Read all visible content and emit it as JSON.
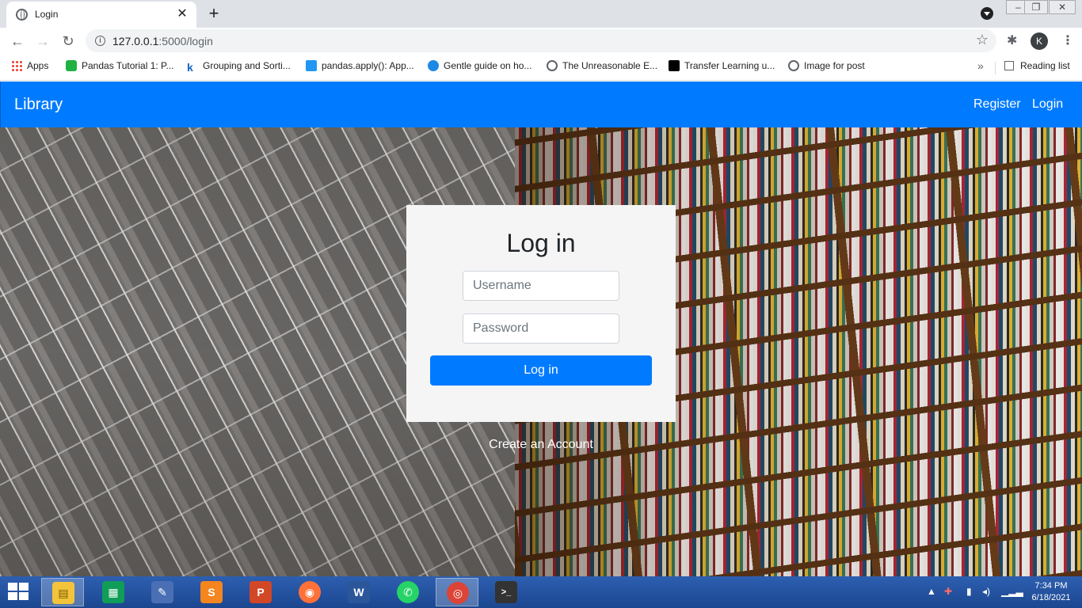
{
  "browser": {
    "tab_title": "Login",
    "tab_close": "✕",
    "new_tab": "+",
    "url_host": "127.0.0.1",
    "url_path": ":5000/login",
    "profile_initial": "K",
    "bookmarks": [
      {
        "label": "Apps",
        "icon": "apps-grid-icon",
        "color": "#ea4335"
      },
      {
        "label": "Pandas Tutorial 1: P...",
        "icon": "pandas-tutorial-icon",
        "color": "#1fb141"
      },
      {
        "label": "Grouping and Sorti...",
        "icon": "k-icon",
        "color": "#1565c0"
      },
      {
        "label": "pandas.apply(): App...",
        "icon": "pandas-apply-icon",
        "color": "#2196f3"
      },
      {
        "label": "Gentle guide on ho...",
        "icon": "gentle-guide-icon",
        "color": "#1e88e5"
      },
      {
        "label": "The Unreasonable E...",
        "icon": "globe-icon",
        "color": "#5f6368"
      },
      {
        "label": "Transfer Learning u...",
        "icon": "medium-icon",
        "color": "#000000"
      },
      {
        "label": "Image for post",
        "icon": "globe-icon",
        "color": "#5f6368"
      }
    ],
    "bookmarks_more": "»",
    "reading_list": "Reading list"
  },
  "navbar": {
    "brand": "Library",
    "links": [
      "Register",
      "Login"
    ],
    "color": "#007bff"
  },
  "login": {
    "title": "Log in",
    "username_placeholder": "Username",
    "password_placeholder": "Password",
    "submit_label": "Log in",
    "create_account": "Create an Account"
  },
  "taskbar": {
    "apps": [
      {
        "name": "file-explorer-icon",
        "glyph": "▤",
        "color": "#f3c43b"
      },
      {
        "name": "store-icon",
        "glyph": "▦",
        "color": "#0f9d58"
      },
      {
        "name": "editor-icon",
        "glyph": "✎",
        "color": "#4a6fb5"
      },
      {
        "name": "sublime-icon",
        "glyph": "S",
        "color": "#f5851f"
      },
      {
        "name": "powerpoint-icon",
        "glyph": "P",
        "color": "#d24726"
      },
      {
        "name": "firefox-icon",
        "glyph": "◉",
        "color": "#ff7139"
      },
      {
        "name": "word-icon",
        "glyph": "W",
        "color": "#2b579a"
      },
      {
        "name": "whatsapp-icon",
        "glyph": "✆",
        "color": "#25d366"
      },
      {
        "name": "chrome-icon",
        "glyph": "◎",
        "color": "#db4437"
      },
      {
        "name": "terminal-icon",
        "glyph": ">_",
        "color": "#333333"
      }
    ],
    "time": "7:34 PM",
    "date": "6/18/2021"
  }
}
